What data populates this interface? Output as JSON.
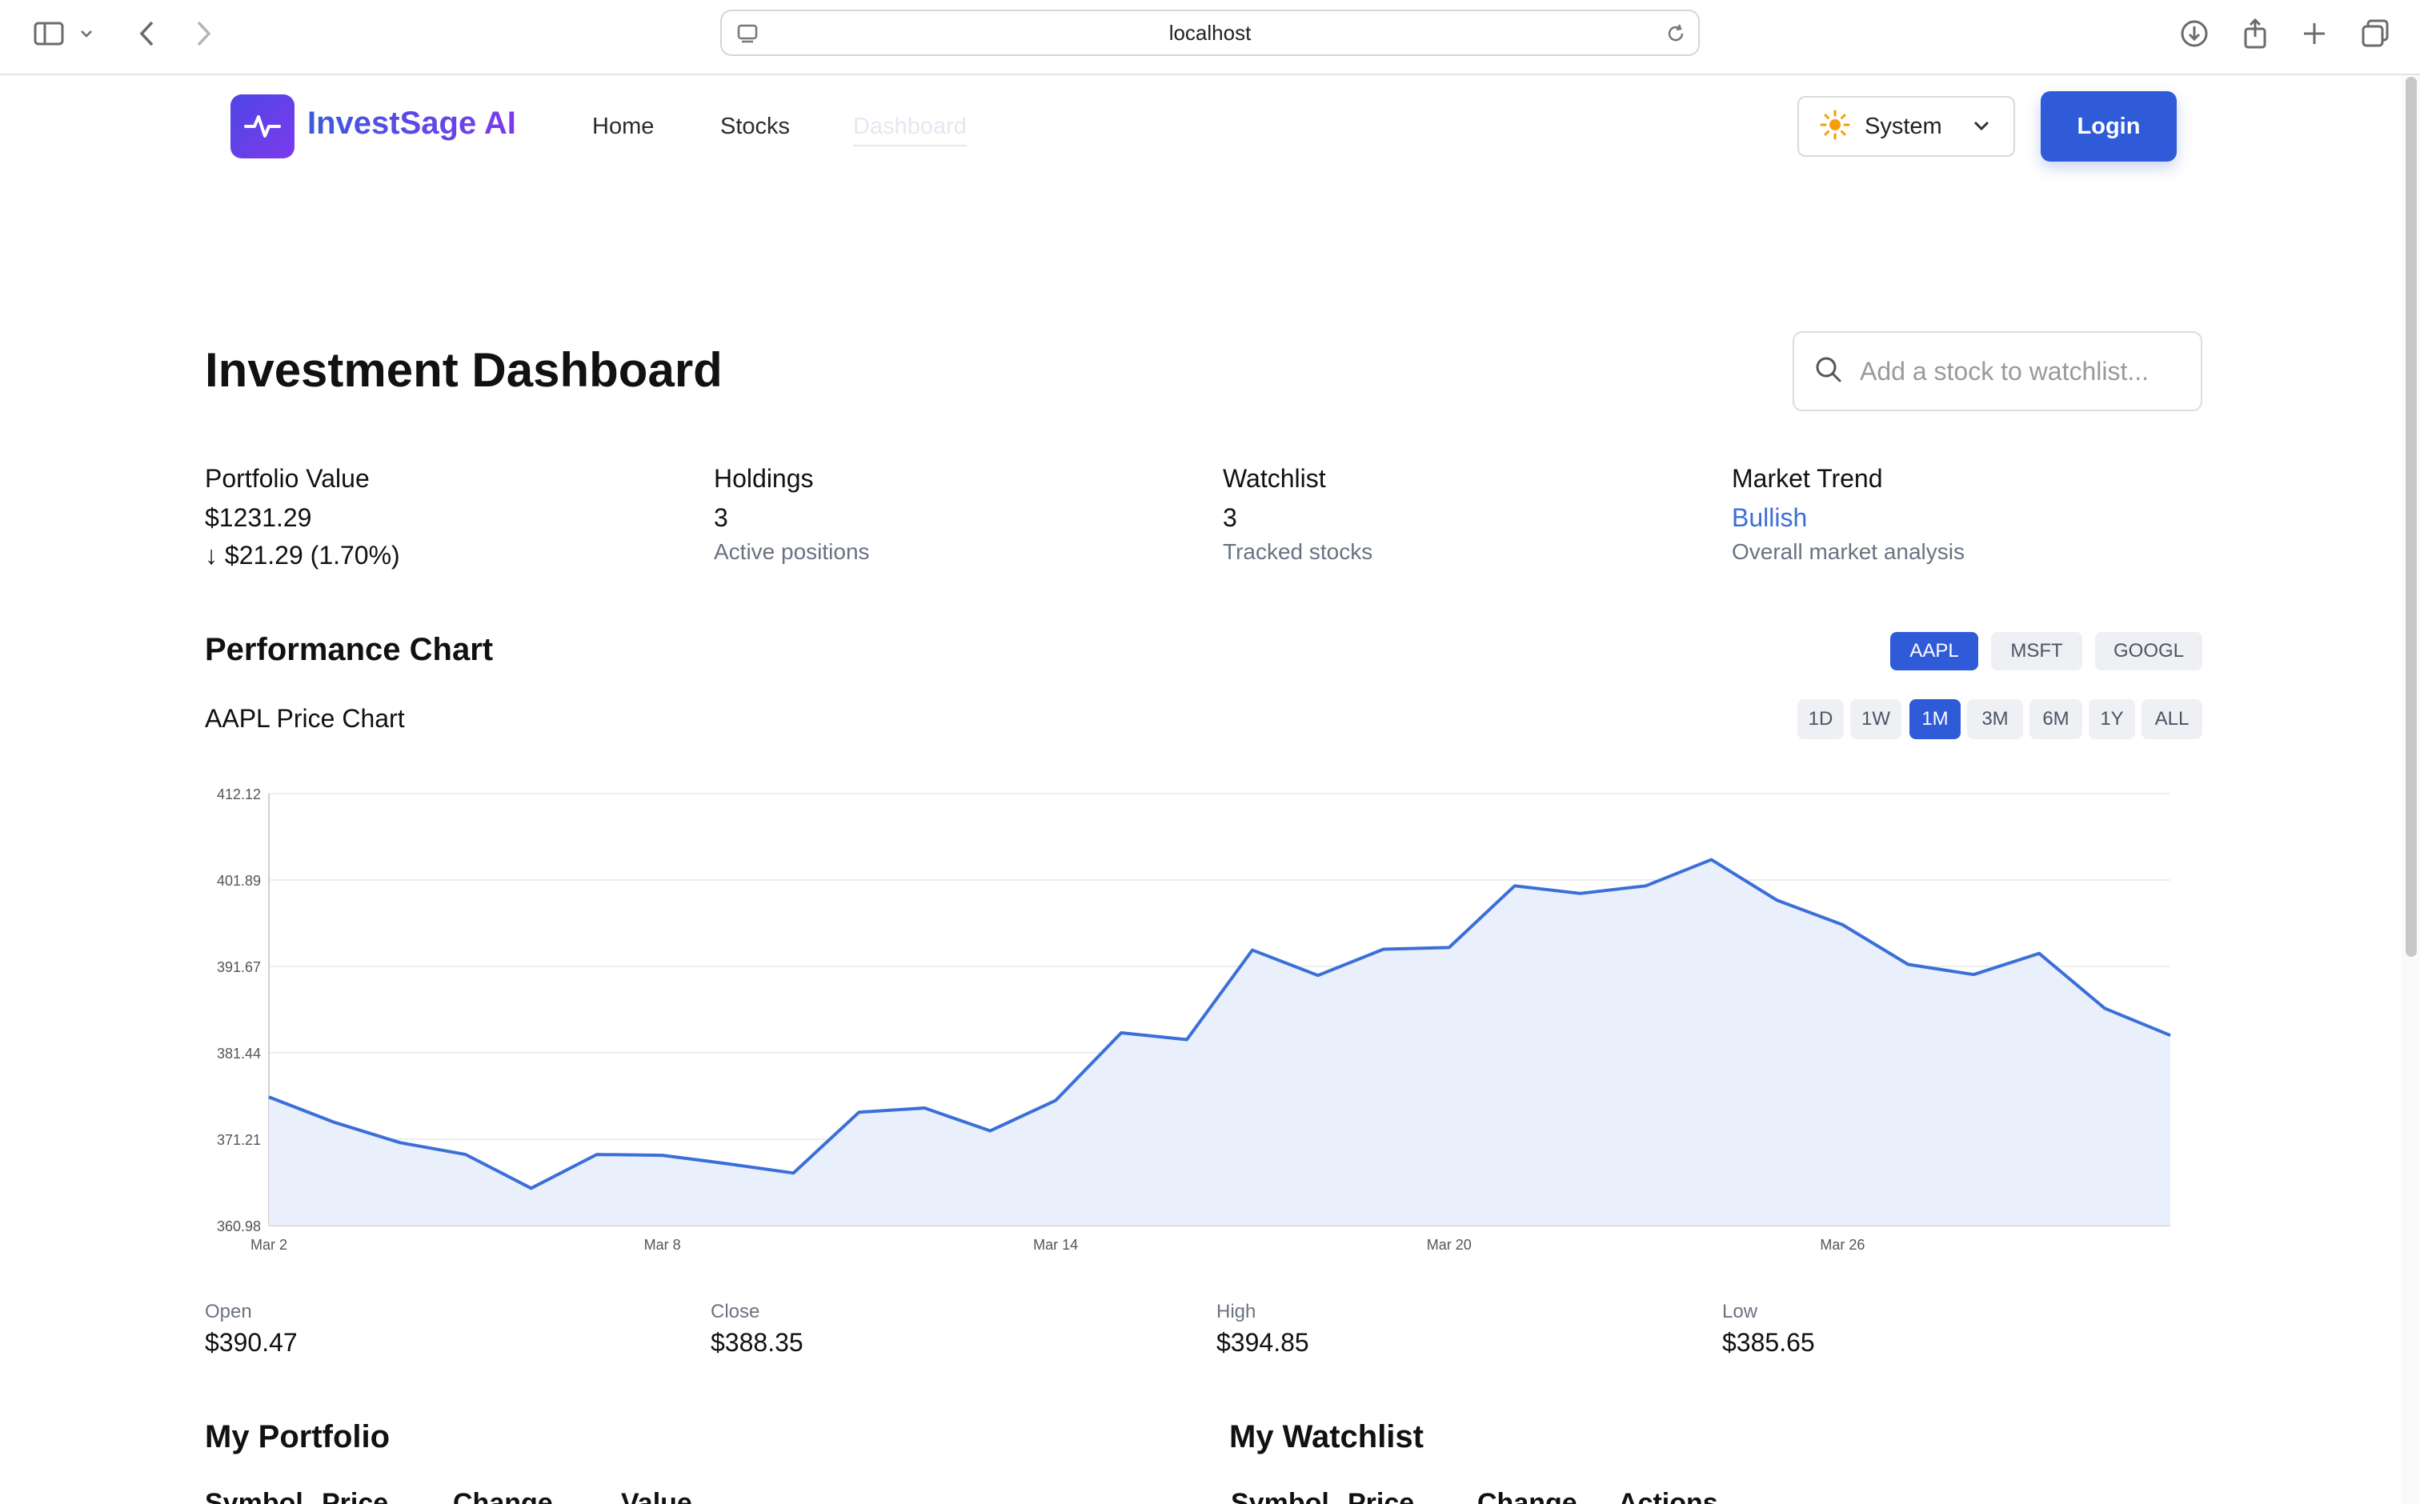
{
  "browser": {
    "url": "localhost"
  },
  "nav": {
    "brand": "InvestSage AI",
    "links": [
      "Home",
      "Stocks",
      "Dashboard"
    ],
    "theme_label": "System",
    "login_label": "Login"
  },
  "header": {
    "title": "Investment Dashboard",
    "search_placeholder": "Add a stock to watchlist..."
  },
  "stats": {
    "portfolio": {
      "label": "Portfolio Value",
      "value": "$1231.29",
      "change": "↓ $21.29 (1.70%)"
    },
    "holdings": {
      "label": "Holdings",
      "value": "3",
      "sub": "Active positions"
    },
    "watchlist": {
      "label": "Watchlist",
      "value": "3",
      "sub": "Tracked stocks"
    },
    "trend": {
      "label": "Market Trend",
      "value": "Bullish",
      "sub": "Overall market analysis"
    }
  },
  "performance": {
    "title": "Performance Chart",
    "tickers": [
      "AAPL",
      "MSFT",
      "GOOGL"
    ],
    "active_ticker": "AAPL",
    "chart_title": "AAPL Price Chart",
    "ranges": [
      "1D",
      "1W",
      "1M",
      "3M",
      "6M",
      "1Y",
      "ALL"
    ],
    "active_range": "1M"
  },
  "colors": {
    "accent": "#2f5bd9",
    "line": "#3b6fd8",
    "area": "#e8eefb",
    "trend_bullish": "#3b6fd8"
  },
  "chart_data": {
    "type": "area",
    "title": "",
    "xlabel": "",
    "ylabel": "",
    "ylim": [
      360.98,
      412.12
    ],
    "yticks": [
      "412.12",
      "401.89",
      "391.67",
      "381.44",
      "371.21",
      "360.98"
    ],
    "xticks": [
      "Mar 2",
      "Mar 8",
      "Mar 14",
      "Mar 20",
      "Mar 26"
    ],
    "series": [
      {
        "values": [
          376.2,
          373.2,
          370.8,
          369.4,
          365.4,
          369.4,
          369.3,
          368.3,
          367.2,
          374.4,
          374.9,
          372.2,
          375.8,
          383.8,
          383.0,
          393.6,
          390.6,
          393.7,
          393.9,
          401.2,
          400.3,
          401.2,
          404.3,
          399.5,
          396.6,
          391.9,
          390.7,
          393.2,
          386.7,
          383.5
        ]
      }
    ]
  },
  "ohlc": {
    "open_label": "Open",
    "open": "$390.47",
    "close_label": "Close",
    "close": "$388.35",
    "high_label": "High",
    "high": "$394.85",
    "low_label": "Low",
    "low": "$385.65"
  },
  "portfolio": {
    "title": "My Portfolio",
    "columns": [
      "Symbol",
      "Price",
      "Change",
      "Value"
    ]
  },
  "watchlist_table": {
    "title": "My Watchlist",
    "columns": [
      "Symbol",
      "Price",
      "Change",
      "Actions"
    ]
  }
}
